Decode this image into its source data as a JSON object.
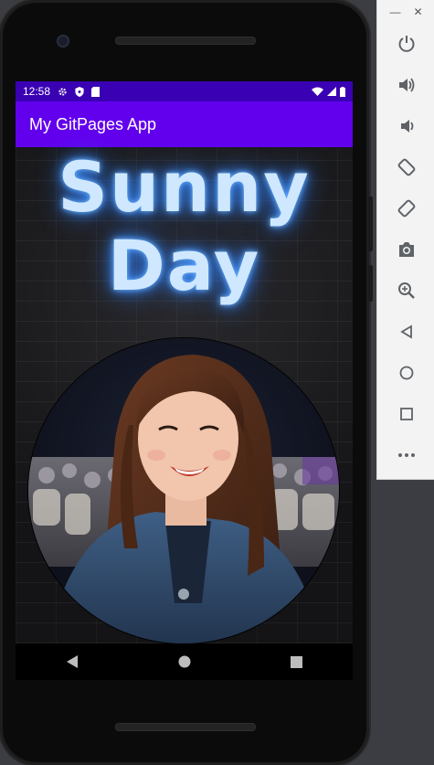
{
  "status_bar": {
    "time": "12:58",
    "left_icons": [
      "gear-icon",
      "shield-icon",
      "sd-card-icon"
    ],
    "right_icons": [
      "wifi-icon",
      "signal-icon",
      "battery-icon"
    ],
    "color": "#3a00b3"
  },
  "app_bar": {
    "title": "My GitPages App",
    "color": "#6200ee"
  },
  "content": {
    "neon_line1": "Sunny",
    "neon_line2": "Day",
    "neon_color": "#cfe8ff",
    "photo": "circular-portrait-photo"
  },
  "nav_bar": {
    "buttons": [
      "back-icon",
      "home-icon",
      "recents-icon"
    ]
  },
  "emulator_toolbar": {
    "window_controls": [
      "minimize-icon",
      "close-icon"
    ],
    "buttons": [
      "power-icon",
      "volume-up-icon",
      "volume-down-icon",
      "rotate-left-icon",
      "rotate-right-icon",
      "camera-icon",
      "zoom-icon",
      "back-icon",
      "home-icon",
      "overview-icon",
      "more-icon"
    ]
  }
}
